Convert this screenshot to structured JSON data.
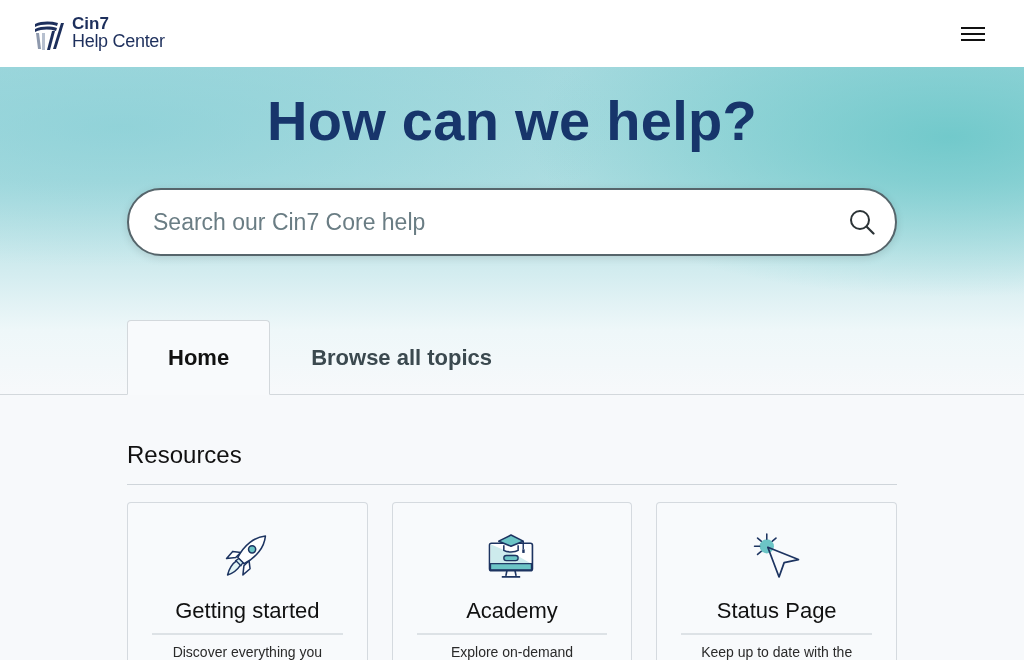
{
  "header": {
    "logo": {
      "brand": "Cin7",
      "subtitle": "Help Center"
    }
  },
  "hero": {
    "title": "How can we help?",
    "search": {
      "placeholder": "Search our Cin7 Core help"
    }
  },
  "tabs": [
    {
      "label": "Home",
      "selected": true
    },
    {
      "label": "Browse all topics",
      "selected": false
    }
  ],
  "resources": {
    "heading": "Resources",
    "cards": [
      {
        "kind": "rocket",
        "title": "Getting started",
        "description": "Discover everything you"
      },
      {
        "kind": "academy",
        "title": "Academy",
        "description": "Explore on-demand"
      },
      {
        "kind": "status",
        "title": "Status Page",
        "description": "Keep up to date with the"
      }
    ]
  }
}
